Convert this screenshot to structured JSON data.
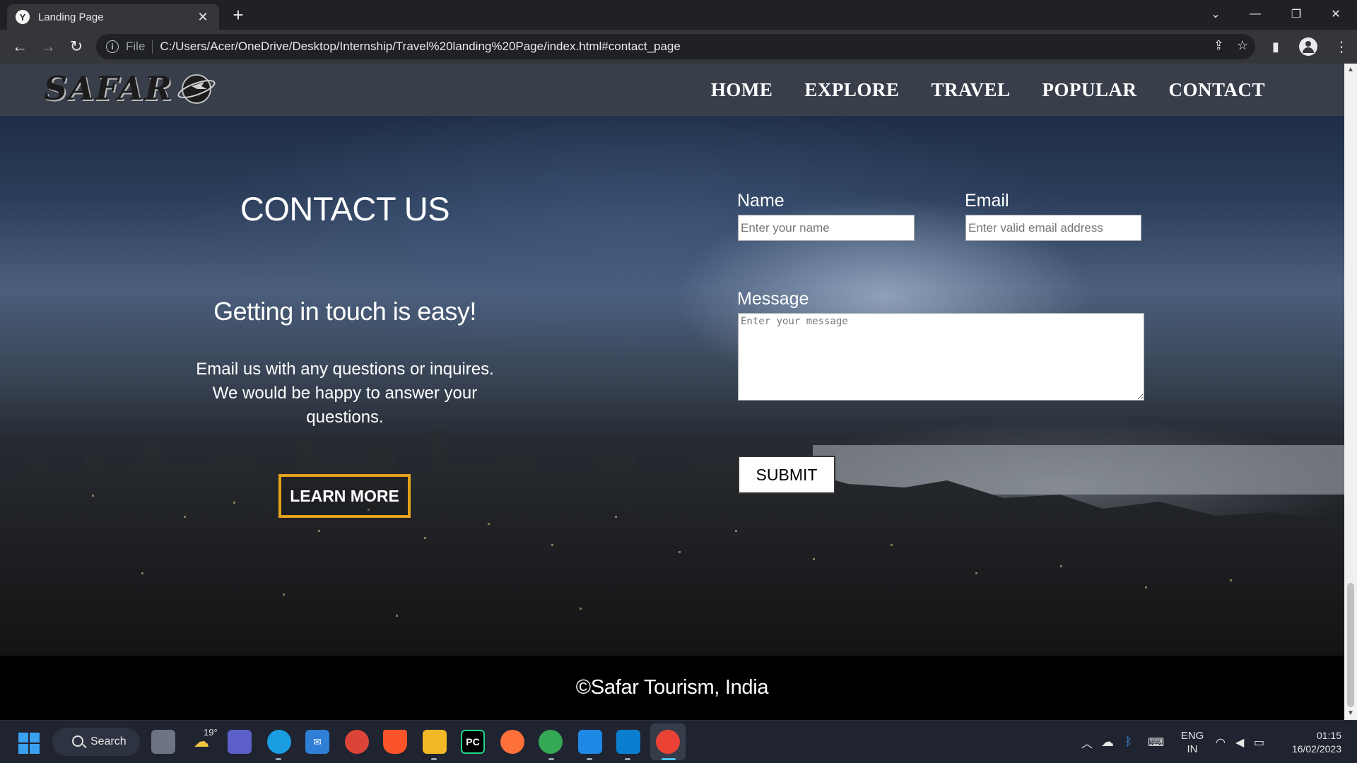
{
  "browser": {
    "tab_title": "Landing Page",
    "favicon_letter": "Y",
    "scheme_label": "File",
    "url": "C:/Users/Acer/OneDrive/Desktop/Internship/Travel%20landing%20Page/index.html#contact_page"
  },
  "site": {
    "logo_text": "SAFAR",
    "nav": [
      "HOME",
      "EXPLORE",
      "TRAVEL",
      "POPULAR",
      "CONTACT"
    ],
    "contact_title": "CONTACT US",
    "subtitle": "Getting in touch is easy!",
    "description": "Email us with any questions or inquires. We would be happy to answer your questions.",
    "learn_more": "LEARN MORE",
    "form": {
      "name_label": "Name",
      "name_placeholder": "Enter your name",
      "email_label": "Email",
      "email_placeholder": "Enter valid email address",
      "message_label": "Message",
      "message_placeholder": "Enter your message",
      "submit": "SUBMIT"
    },
    "footer": "©Safar Tourism, India"
  },
  "taskbar": {
    "search_label": "Search",
    "weather_temp": "19°",
    "pycharm_label": "PC",
    "lang_primary": "ENG",
    "lang_secondary": "IN",
    "time": "01:15",
    "date": "16/02/2023"
  },
  "colors": {
    "learn_more_border": "#e3a21a",
    "navbar_bg": "#3c424c",
    "footer_bg": "#000000"
  }
}
